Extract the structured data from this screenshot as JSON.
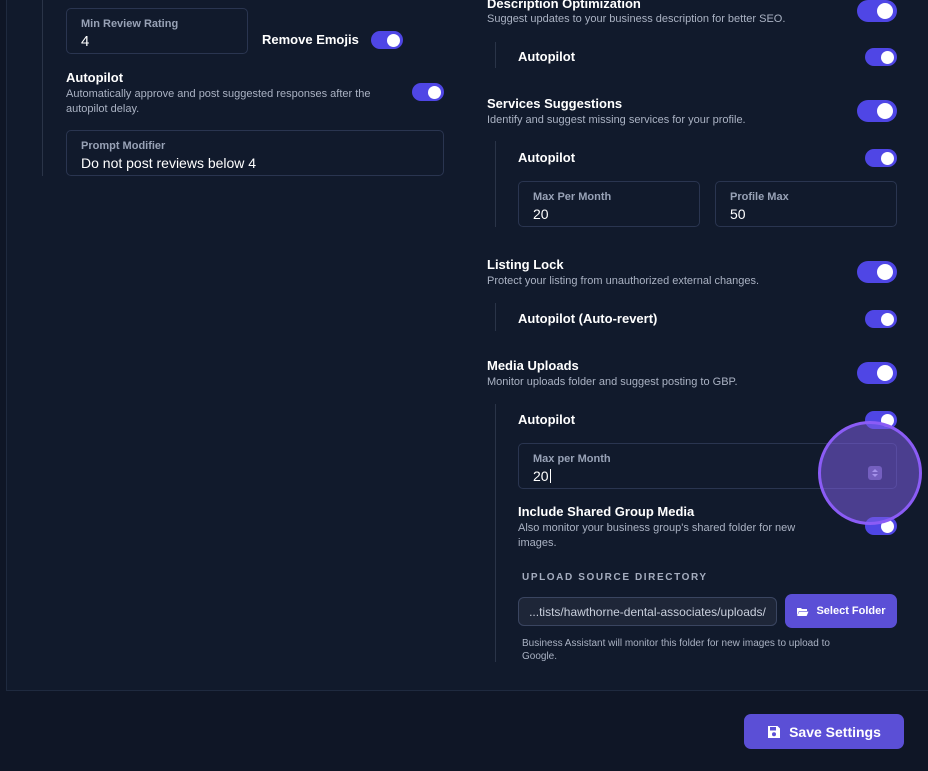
{
  "left": {
    "min_review": {
      "label": "Min Review Rating",
      "value": "4"
    },
    "remove_emojis": {
      "label": "Remove Emojis",
      "on": true
    },
    "autopilot": {
      "title": "Autopilot",
      "desc_line1": "Automatically approve and post suggested responses after the",
      "desc_line2": "autopilot delay.",
      "on": true
    },
    "prompt_modifier": {
      "label": "Prompt Modifier",
      "value": "Do not post reviews below 4"
    }
  },
  "right": {
    "description_optimization": {
      "title": "Description Optimization",
      "desc": "Suggest updates to your business description for better SEO.",
      "on": true,
      "autopilot_label": "Autopilot",
      "autopilot_on": true
    },
    "services_suggestions": {
      "title": "Services Suggestions",
      "desc": "Identify and suggest missing services for your profile.",
      "on": true,
      "autopilot_label": "Autopilot",
      "autopilot_on": true,
      "max_per_month": {
        "label": "Max Per Month",
        "value": "20"
      },
      "profile_max": {
        "label": "Profile Max",
        "value": "50"
      }
    },
    "listing_lock": {
      "title": "Listing Lock",
      "desc": "Protect your listing from unauthorized external changes.",
      "on": true,
      "autopilot_label": "Autopilot (Auto-revert)",
      "autopilot_on": true
    },
    "media_uploads": {
      "title": "Media Uploads",
      "desc": "Monitor uploads folder and suggest posting to GBP.",
      "on": true,
      "autopilot_label": "Autopilot",
      "autopilot_on": true,
      "max_per_month": {
        "label": "Max per Month",
        "value": "20"
      },
      "shared_group": {
        "title": "Include Shared Group Media",
        "desc_line1": "Also monitor your business group's shared folder for new",
        "desc_line2": "images.",
        "on": true
      },
      "upload_source_label": "UPLOAD SOURCE DIRECTORY",
      "path_value": "...tists/hawthorne-dental-associates/uploads/",
      "select_folder_label": "Select Folder",
      "helper_line1": "Business Assistant will monitor this folder for new images to upload to",
      "helper_line2": "Google."
    }
  },
  "footer": {
    "save_label": "Save Settings"
  },
  "colors": {
    "accent": "#4f46e5",
    "button": "#5b4fd6",
    "background": "#111a2c"
  },
  "icons": {
    "folder": "folder-open-icon",
    "save": "floppy-disk-icon",
    "stepper": "stepper-arrows-icon"
  }
}
